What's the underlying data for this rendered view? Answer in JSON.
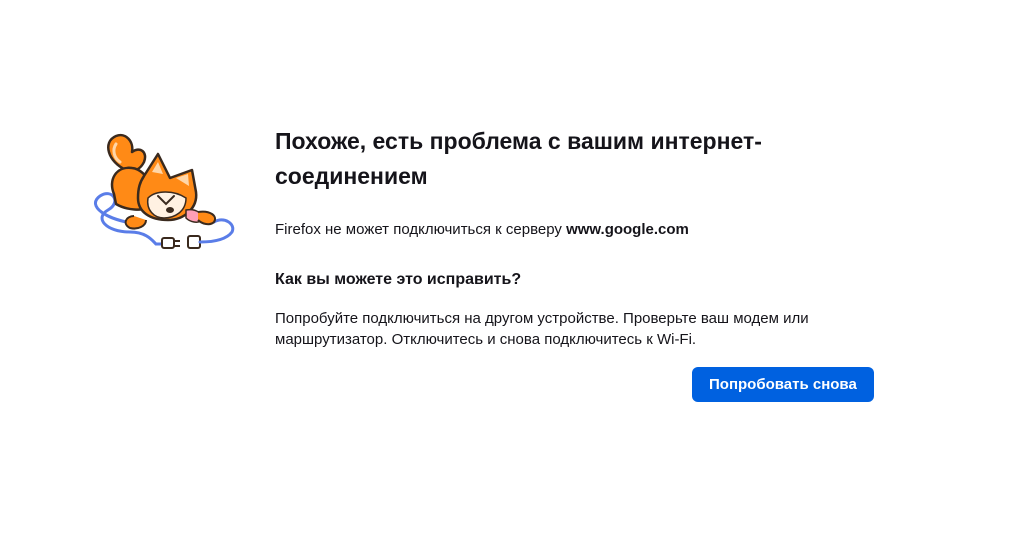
{
  "error": {
    "title": "Похоже, есть проблема с вашим интернет-соединением",
    "desc_prefix": "Firefox не может подключиться к серверу ",
    "host": "www.google.com",
    "fix_heading": "Как вы можете это исправить?",
    "advice": "Попробуйте подключиться на другом устройстве. Проверьте ваш модем или маршрутизатор. Отключитесь и снова подключитесь к Wi-Fi.",
    "retry_label": "Попробовать снова"
  },
  "illustration": {
    "icon": "fox-unplugged-cable-icon",
    "colors": {
      "fox_orange": "#ff8a16",
      "fox_outline": "#3a2a1e",
      "cable_blue": "#5a7de8"
    }
  },
  "colors": {
    "accent": "#0061e0",
    "text": "#15141a",
    "background": "#ffffff"
  }
}
